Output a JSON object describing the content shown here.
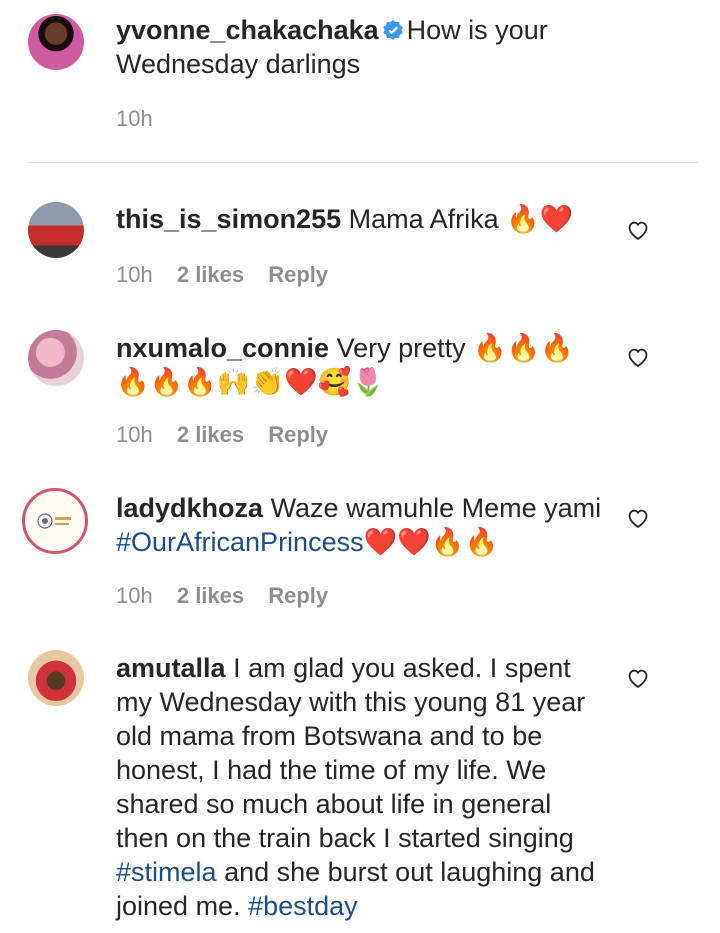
{
  "caption": {
    "username": "yvonne_chakachaka",
    "text": "How is your Wednesday darlings",
    "time": "10h"
  },
  "comments": [
    {
      "username": "this_is_simon255",
      "text": "Mama Afrika 🔥❤️",
      "time": "10h",
      "likes": "2 likes",
      "reply": "Reply"
    },
    {
      "username": "nxumalo_connie",
      "text": "Very pretty 🔥🔥🔥🔥🔥🔥🙌👏❤️🥰🌷",
      "time": "10h",
      "likes": "2 likes",
      "reply": "Reply"
    },
    {
      "username": "ladydkhoza",
      "text": "Waze wamuhle Meme yami",
      "hashtag": "#OurAfricanPrincess",
      "text_after": "❤️❤️🔥🔥",
      "time": "10h",
      "likes": "2 likes",
      "reply": "Reply"
    },
    {
      "username": "amutalla",
      "text": "I am glad you asked. I spent my Wednesday with this young 81 year old mama from Botswana and to be honest, I had the time of my life. We shared so much about life in general then on the train back I started singing",
      "hashtag": "#stimela",
      "text_after": "and she burst out laughing and joined me.",
      "hashtag2": "#bestday"
    }
  ],
  "icons": {
    "like": "heart-outline-icon",
    "verified": "verified-badge-icon"
  },
  "colors": {
    "hashtag": "#1b4d8a",
    "meta": "#8e8e8e",
    "verified": "#3897f0"
  }
}
